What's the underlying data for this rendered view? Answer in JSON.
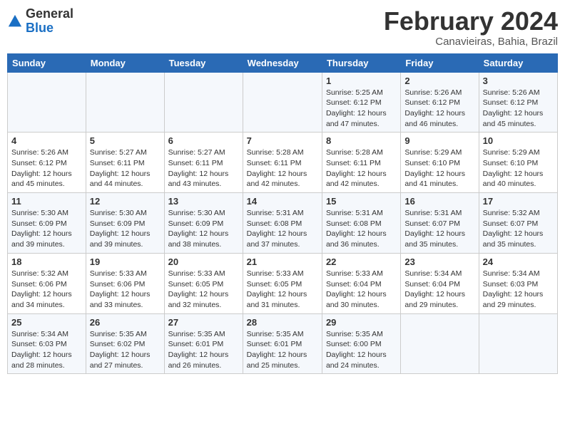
{
  "header": {
    "logo_general": "General",
    "logo_blue": "Blue",
    "month_year": "February 2024",
    "location": "Canavieiras, Bahia, Brazil"
  },
  "weekdays": [
    "Sunday",
    "Monday",
    "Tuesday",
    "Wednesday",
    "Thursday",
    "Friday",
    "Saturday"
  ],
  "weeks": [
    [
      {
        "day": "",
        "info": ""
      },
      {
        "day": "",
        "info": ""
      },
      {
        "day": "",
        "info": ""
      },
      {
        "day": "",
        "info": ""
      },
      {
        "day": "1",
        "info": "Sunrise: 5:25 AM\nSunset: 6:12 PM\nDaylight: 12 hours\nand 47 minutes."
      },
      {
        "day": "2",
        "info": "Sunrise: 5:26 AM\nSunset: 6:12 PM\nDaylight: 12 hours\nand 46 minutes."
      },
      {
        "day": "3",
        "info": "Sunrise: 5:26 AM\nSunset: 6:12 PM\nDaylight: 12 hours\nand 45 minutes."
      }
    ],
    [
      {
        "day": "4",
        "info": "Sunrise: 5:26 AM\nSunset: 6:12 PM\nDaylight: 12 hours\nand 45 minutes."
      },
      {
        "day": "5",
        "info": "Sunrise: 5:27 AM\nSunset: 6:11 PM\nDaylight: 12 hours\nand 44 minutes."
      },
      {
        "day": "6",
        "info": "Sunrise: 5:27 AM\nSunset: 6:11 PM\nDaylight: 12 hours\nand 43 minutes."
      },
      {
        "day": "7",
        "info": "Sunrise: 5:28 AM\nSunset: 6:11 PM\nDaylight: 12 hours\nand 42 minutes."
      },
      {
        "day": "8",
        "info": "Sunrise: 5:28 AM\nSunset: 6:11 PM\nDaylight: 12 hours\nand 42 minutes."
      },
      {
        "day": "9",
        "info": "Sunrise: 5:29 AM\nSunset: 6:10 PM\nDaylight: 12 hours\nand 41 minutes."
      },
      {
        "day": "10",
        "info": "Sunrise: 5:29 AM\nSunset: 6:10 PM\nDaylight: 12 hours\nand 40 minutes."
      }
    ],
    [
      {
        "day": "11",
        "info": "Sunrise: 5:30 AM\nSunset: 6:09 PM\nDaylight: 12 hours\nand 39 minutes."
      },
      {
        "day": "12",
        "info": "Sunrise: 5:30 AM\nSunset: 6:09 PM\nDaylight: 12 hours\nand 39 minutes."
      },
      {
        "day": "13",
        "info": "Sunrise: 5:30 AM\nSunset: 6:09 PM\nDaylight: 12 hours\nand 38 minutes."
      },
      {
        "day": "14",
        "info": "Sunrise: 5:31 AM\nSunset: 6:08 PM\nDaylight: 12 hours\nand 37 minutes."
      },
      {
        "day": "15",
        "info": "Sunrise: 5:31 AM\nSunset: 6:08 PM\nDaylight: 12 hours\nand 36 minutes."
      },
      {
        "day": "16",
        "info": "Sunrise: 5:31 AM\nSunset: 6:07 PM\nDaylight: 12 hours\nand 35 minutes."
      },
      {
        "day": "17",
        "info": "Sunrise: 5:32 AM\nSunset: 6:07 PM\nDaylight: 12 hours\nand 35 minutes."
      }
    ],
    [
      {
        "day": "18",
        "info": "Sunrise: 5:32 AM\nSunset: 6:06 PM\nDaylight: 12 hours\nand 34 minutes."
      },
      {
        "day": "19",
        "info": "Sunrise: 5:33 AM\nSunset: 6:06 PM\nDaylight: 12 hours\nand 33 minutes."
      },
      {
        "day": "20",
        "info": "Sunrise: 5:33 AM\nSunset: 6:05 PM\nDaylight: 12 hours\nand 32 minutes."
      },
      {
        "day": "21",
        "info": "Sunrise: 5:33 AM\nSunset: 6:05 PM\nDaylight: 12 hours\nand 31 minutes."
      },
      {
        "day": "22",
        "info": "Sunrise: 5:33 AM\nSunset: 6:04 PM\nDaylight: 12 hours\nand 30 minutes."
      },
      {
        "day": "23",
        "info": "Sunrise: 5:34 AM\nSunset: 6:04 PM\nDaylight: 12 hours\nand 29 minutes."
      },
      {
        "day": "24",
        "info": "Sunrise: 5:34 AM\nSunset: 6:03 PM\nDaylight: 12 hours\nand 29 minutes."
      }
    ],
    [
      {
        "day": "25",
        "info": "Sunrise: 5:34 AM\nSunset: 6:03 PM\nDaylight: 12 hours\nand 28 minutes."
      },
      {
        "day": "26",
        "info": "Sunrise: 5:35 AM\nSunset: 6:02 PM\nDaylight: 12 hours\nand 27 minutes."
      },
      {
        "day": "27",
        "info": "Sunrise: 5:35 AM\nSunset: 6:01 PM\nDaylight: 12 hours\nand 26 minutes."
      },
      {
        "day": "28",
        "info": "Sunrise: 5:35 AM\nSunset: 6:01 PM\nDaylight: 12 hours\nand 25 minutes."
      },
      {
        "day": "29",
        "info": "Sunrise: 5:35 AM\nSunset: 6:00 PM\nDaylight: 12 hours\nand 24 minutes."
      },
      {
        "day": "",
        "info": ""
      },
      {
        "day": "",
        "info": ""
      }
    ]
  ]
}
